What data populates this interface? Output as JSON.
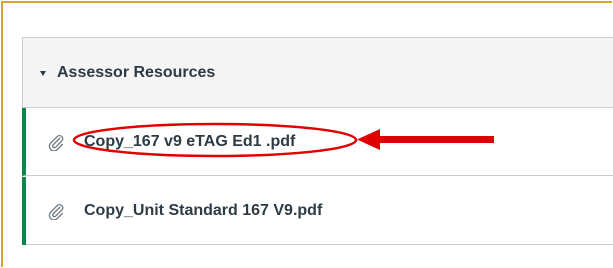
{
  "module": {
    "title": "Assessor Resources",
    "collapse_icon": "caret-down-icon",
    "items": [
      {
        "label": "Copy_167 v9 eTAG Ed1 .pdf",
        "icon": "paperclip-icon"
      },
      {
        "label": "Copy_Unit Standard 167 V9.pdf",
        "icon": "paperclip-icon"
      }
    ]
  },
  "colors": {
    "frame_border": "#d4a72c",
    "item_accent": "#0b874b",
    "text": "#2d3b45",
    "annotation": "#e00000"
  }
}
